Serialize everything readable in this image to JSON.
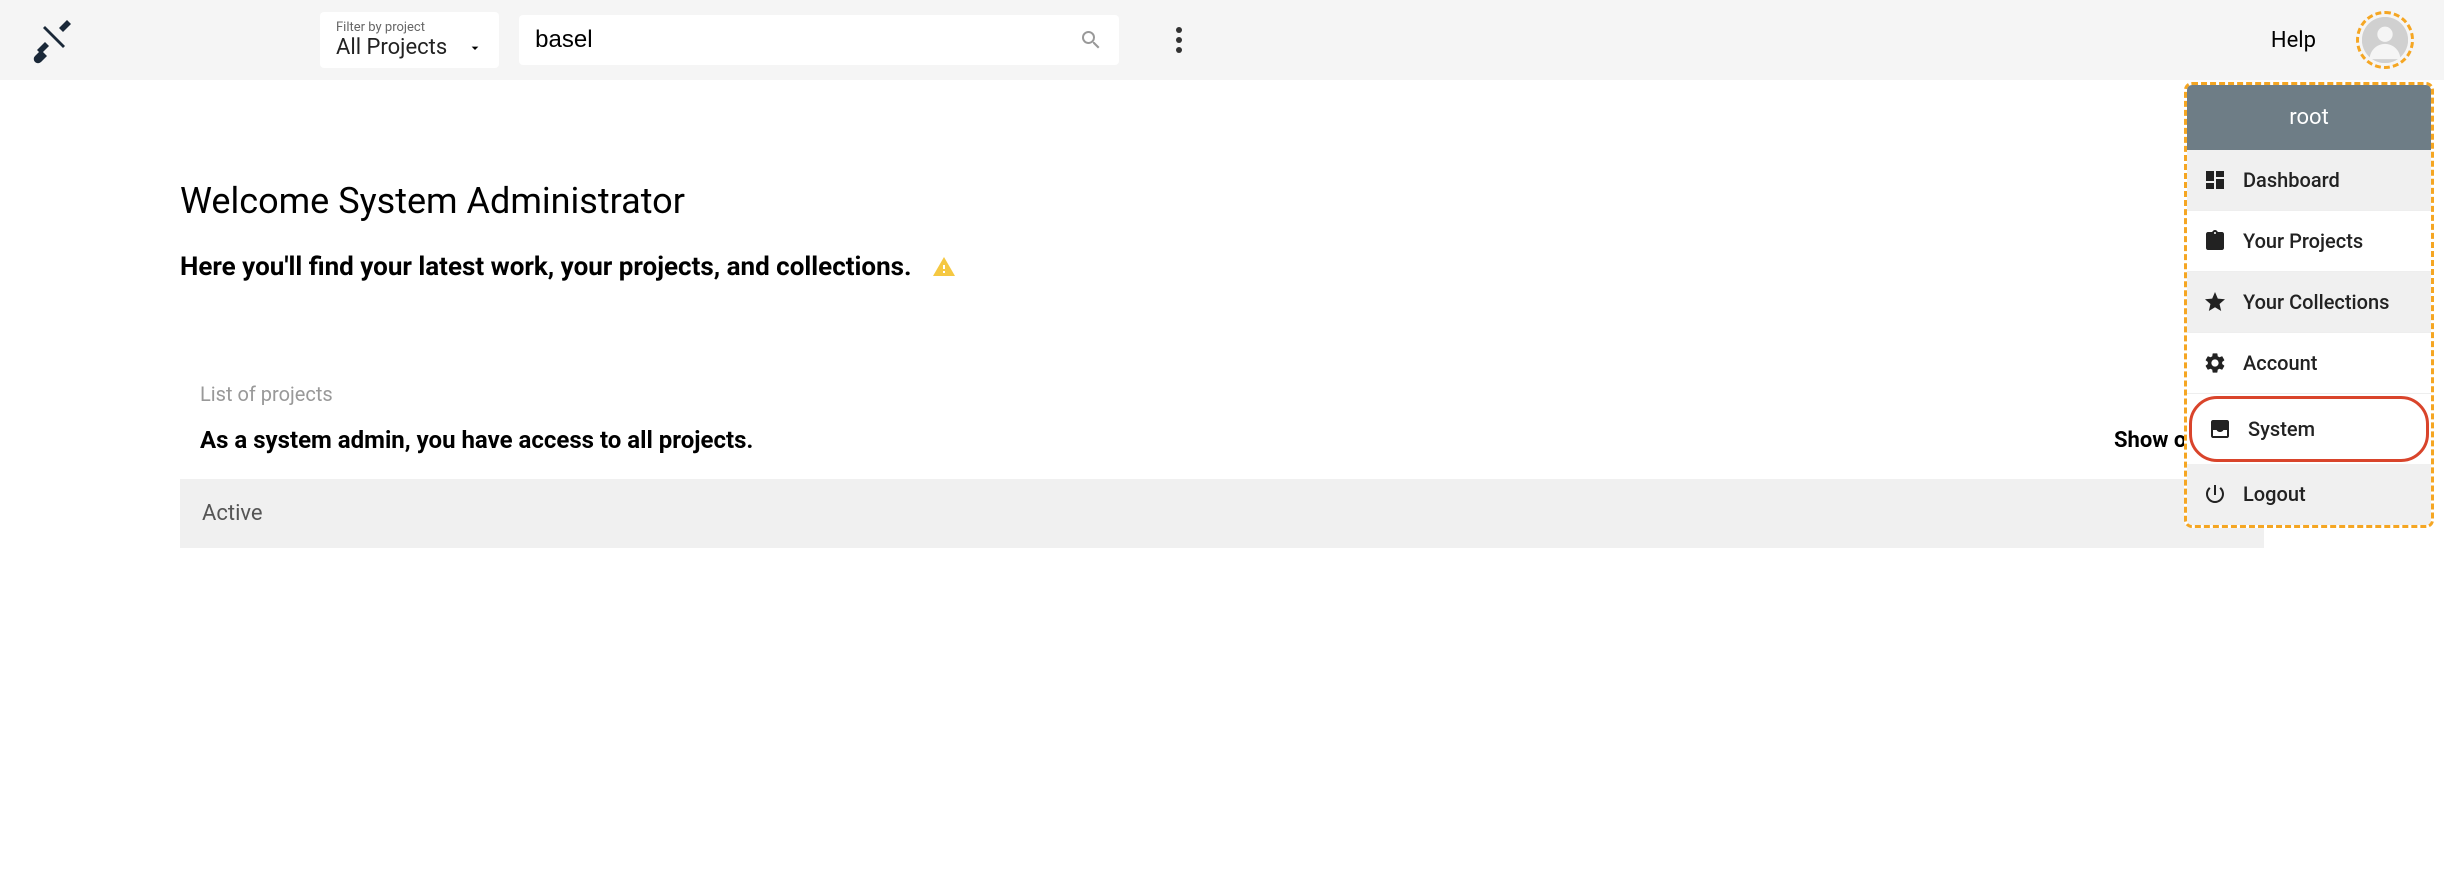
{
  "header": {
    "filter_label": "Filter by project",
    "filter_value": "All Projects",
    "search_value": "basel",
    "search_placeholder": "",
    "help_label": "Help"
  },
  "main": {
    "welcome_heading": "Welcome System Administrator",
    "welcome_subtext": "Here you'll find your latest work, your projects, and collections.",
    "list_label": "List of projects",
    "access_text": "As a system admin, you have access to all projects.",
    "show_only_label": "Show only my projects",
    "active_panel": "Active"
  },
  "user_menu": {
    "username": "root",
    "items": [
      {
        "label": "Dashboard",
        "icon": "dashboard-icon",
        "shaded": true,
        "highlighted": false
      },
      {
        "label": "Your Projects",
        "icon": "clipboard-icon",
        "shaded": false,
        "highlighted": false
      },
      {
        "label": "Your Collections",
        "icon": "star-icon",
        "shaded": true,
        "highlighted": false
      },
      {
        "label": "Account",
        "icon": "gear-icon",
        "shaded": false,
        "highlighted": false
      },
      {
        "label": "System",
        "icon": "inbox-icon",
        "shaded": false,
        "highlighted": true
      },
      {
        "label": "Logout",
        "icon": "power-icon",
        "shaded": true,
        "highlighted": false
      }
    ]
  }
}
